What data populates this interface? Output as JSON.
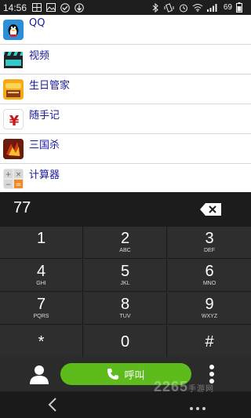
{
  "status_bar": {
    "time": "14:56",
    "battery_percent": "69",
    "left_icons": [
      "gallery-icon",
      "image-icon",
      "check-circle-icon",
      "download-icon"
    ],
    "right_icons": [
      "bluetooth-icon",
      "vibrate-icon",
      "alarm-icon",
      "wifi-icon",
      "signal-icon",
      "battery-icon"
    ]
  },
  "apps": [
    {
      "name": "QQ",
      "icon": "qq-penguin-icon"
    },
    {
      "name": "视频",
      "icon": "video-clapper-icon"
    },
    {
      "name": "生日管家",
      "icon": "birthday-icon"
    },
    {
      "name": "随手记",
      "icon": "yen-icon"
    },
    {
      "name": "三国杀",
      "icon": "sanguosha-icon"
    },
    {
      "name": "计算器",
      "icon": "calculator-icon"
    }
  ],
  "dialer": {
    "number": "77",
    "keys": [
      {
        "digit": "1",
        "letters": ""
      },
      {
        "digit": "2",
        "letters": "ABC"
      },
      {
        "digit": "3",
        "letters": "DEF"
      },
      {
        "digit": "4",
        "letters": "GHI"
      },
      {
        "digit": "5",
        "letters": "JKL"
      },
      {
        "digit": "6",
        "letters": "MNO"
      },
      {
        "digit": "7",
        "letters": "PQRS"
      },
      {
        "digit": "8",
        "letters": "TUV"
      },
      {
        "digit": "9",
        "letters": "WXYZ"
      },
      {
        "digit": "*",
        "letters": ""
      },
      {
        "digit": "0",
        "letters": ""
      },
      {
        "digit": "#",
        "letters": ""
      }
    ],
    "call_label": "呼叫"
  },
  "watermark": {
    "main": "2265",
    "sub": "手游网"
  },
  "colors": {
    "call_green": "#5dbb1c",
    "app_name_blue": "#1a1aa0",
    "keypad_bg": "#2e2e2e"
  }
}
